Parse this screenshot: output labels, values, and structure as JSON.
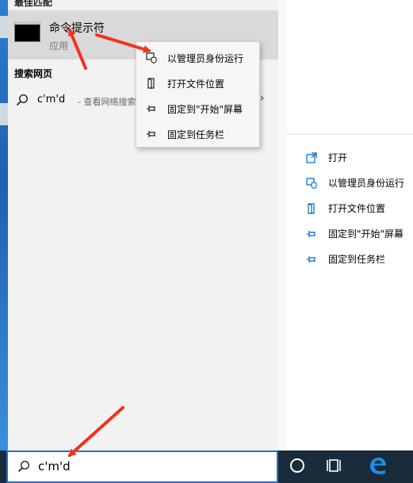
{
  "start_menu": {
    "best_match_header": "最佳匹配",
    "best_match": {
      "title": "命令提示符",
      "subtitle": "应用"
    },
    "web_header": "搜索网页",
    "web_result": {
      "query": "c'm'd",
      "description": "- 查看网络搜索",
      "arrow": "›"
    }
  },
  "context_menu": {
    "items": [
      {
        "label": "以管理员身份运行",
        "icon": "admin-shield-icon"
      },
      {
        "label": "打开文件位置",
        "icon": "file-location-icon"
      },
      {
        "label": "固定到\"开始\"屏幕",
        "icon": "pin-icon"
      },
      {
        "label": "固定到任务栏",
        "icon": "pin-icon"
      }
    ]
  },
  "detail_pane": {
    "actions": [
      {
        "label": "打开",
        "icon": "open-icon"
      },
      {
        "label": "以管理员身份运行",
        "icon": "admin-shield-icon"
      },
      {
        "label": "打开文件位置",
        "icon": "file-location-icon"
      },
      {
        "label": "固定到\"开始\"屏幕",
        "icon": "pin-icon"
      },
      {
        "label": "固定到任务栏",
        "icon": "pin-icon"
      }
    ]
  },
  "taskbar": {
    "search_value": "c'm'd",
    "icons": [
      "cortana-icon",
      "task-view-icon",
      "edge-icon"
    ]
  },
  "colors": {
    "accent": "#0067c0",
    "selection": "#d9d9d9",
    "annotation": "#f2321e",
    "taskbar": "#1a2b3c"
  }
}
